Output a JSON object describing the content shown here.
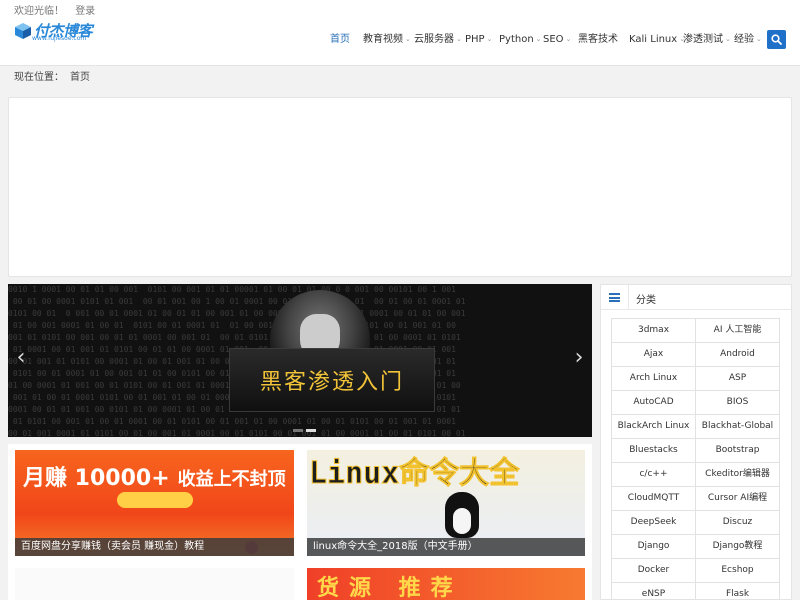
{
  "header": {
    "welcome": "欢迎光临！",
    "login": "登录",
    "logo_text": "付杰博客",
    "logo_url": "www.fujiesoe.com"
  },
  "nav": {
    "items": [
      {
        "label": "首页",
        "active": true,
        "dropdown": false
      },
      {
        "label": "教育视频",
        "dropdown": true
      },
      {
        "label": "云服务器",
        "dropdown": true
      },
      {
        "label": "PHP",
        "dropdown": true
      },
      {
        "label": "Python",
        "dropdown": true
      },
      {
        "label": "SEO",
        "dropdown": true
      },
      {
        "label": "黑客技术",
        "dropdown": false
      },
      {
        "label": "Kali Linux",
        "dropdown": true
      },
      {
        "label": "渗透测试",
        "dropdown": true
      },
      {
        "label": "经验",
        "dropdown": true
      }
    ],
    "search_icon": "search-icon",
    "accent_color": "#1e70c8"
  },
  "breadcrumb": {
    "label": "现在位置：",
    "current": "首页"
  },
  "slider": {
    "caption": "黑客渗透入门",
    "prev_icon": "chevron-left-icon",
    "next_icon": "chevron-right-icon",
    "slides": 2,
    "current_slide": 2
  },
  "cards": [
    {
      "title": "百度网盘分享赚钱（卖会员 赚现金）教程",
      "banner_text": "月赚 10000+",
      "banner_sub": "收益上不封顶"
    },
    {
      "title": "linux命令大全_2018版（中文手册）",
      "banner_text": "Linux命令大全"
    },
    {
      "title": ""
    },
    {
      "title": "",
      "banner_text": "货源 推荐"
    }
  ],
  "sidebar": {
    "title": "分类",
    "categories": [
      "3dmax",
      "AI 人工智能",
      "Ajax",
      "Android",
      "Arch Linux",
      "ASP",
      "AutoCAD",
      "BIOS",
      "BlackArch Linux",
      "Blackhat-Global",
      "Bluestacks",
      "Bootstrap",
      "c/c++",
      "Ckeditor编辑器",
      "CloudMQTT",
      "Cursor AI编程",
      "DeepSeek",
      "Discuz",
      "Django",
      "Django教程",
      "Docker",
      "Ecshop",
      "eNSP",
      "Flask"
    ]
  }
}
